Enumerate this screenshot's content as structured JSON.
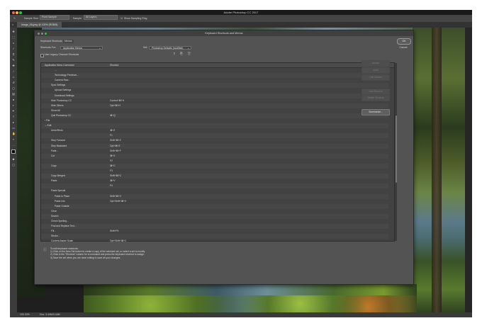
{
  "app": {
    "title": "Adobe Photoshop CC 2017"
  },
  "options_bar": {
    "sample_size_label": "Sample Size:",
    "sample_size_value": "Point Sample",
    "sample_label": "Sample:",
    "sample_value": "All Layers",
    "show_ring_label": "Show Sampling Ring"
  },
  "document": {
    "tab_label": "Image_06.jpeg @ 100% (RGB/8)",
    "zoom": "100.33%",
    "doc_info": "Doc: 3.44M/3.44M"
  },
  "dialog": {
    "title": "Keyboard Shortcuts and Menus",
    "tab_label": "Keyboard Shortcuts",
    "tab2_label": "Menus",
    "shortcuts_for_label": "Shortcuts For:",
    "shortcuts_for_value": "Application Menus",
    "set_label": "Set:",
    "set_value": "Photoshop Defaults (modified)",
    "legacy_label": "Use Legacy Channel Shortcuts",
    "col_command": "Application Menu Command",
    "col_shortcut": "Shortcut",
    "buttons": {
      "accept": "Accept",
      "undo": "Undo",
      "use_default": "Use Default",
      "add_shortcut": "Add Shortcut",
      "delete_shortcut": "Delete Shortcut",
      "summarize": "Summarize..."
    },
    "ok": "OK",
    "cancel": "Cancel",
    "instructions": [
      "To edit keyboard shortcuts:",
      "1) Click on the New Set button to create a copy of the selected set, or select a set to modify.",
      "2) Click in the \"Shortcut\" column for a command and press the keyboard shortcut to assign.",
      "3) Save the set when you are done editing to save all your changes."
    ],
    "rows": [
      {
        "cmd": "...",
        "sc": "",
        "indent": 2
      },
      {
        "cmd": "Technology Previews...",
        "sc": "",
        "indent": 2
      },
      {
        "cmd": "Camera Raw...",
        "sc": "",
        "indent": 2
      },
      {
        "cmd": "Sync Settings",
        "sc": "",
        "indent": 1
      },
      {
        "cmd": "Upload Settings",
        "sc": "",
        "indent": 2
      },
      {
        "cmd": "Download Settings",
        "sc": "",
        "indent": 2
      },
      {
        "cmd": "Hide Photoshop CC",
        "sc": "Control+⌘+H",
        "indent": 1
      },
      {
        "cmd": "Hide Others",
        "sc": "Opt+⌘+H",
        "indent": 1
      },
      {
        "cmd": "Show All",
        "sc": "",
        "indent": 1
      },
      {
        "cmd": "Quit Photoshop CC",
        "sc": "⌘+Q",
        "indent": 1
      },
      {
        "cmd": "› File",
        "sc": "",
        "indent": 0
      },
      {
        "cmd": "⌄ Edit",
        "sc": "",
        "indent": 0
      },
      {
        "cmd": "Undo/Redo",
        "sc": "⌘+Z",
        "indent": 1
      },
      {
        "cmd": "",
        "sc": "F1",
        "indent": 1
      },
      {
        "cmd": "Step Forward",
        "sc": "Shift+⌘+Z",
        "indent": 1
      },
      {
        "cmd": "Step Backward",
        "sc": "Opt+⌘+Z",
        "indent": 1
      },
      {
        "cmd": "Fade...",
        "sc": "Shift+⌘+F",
        "indent": 1
      },
      {
        "cmd": "Cut",
        "sc": "⌘+X",
        "indent": 1
      },
      {
        "cmd": "",
        "sc": "F2",
        "indent": 1
      },
      {
        "cmd": "Copy",
        "sc": "⌘+C",
        "indent": 1
      },
      {
        "cmd": "",
        "sc": "F3",
        "indent": 1
      },
      {
        "cmd": "Copy Merged",
        "sc": "Shift+⌘+C",
        "indent": 1
      },
      {
        "cmd": "Paste",
        "sc": "⌘+V",
        "indent": 1
      },
      {
        "cmd": "",
        "sc": "F4",
        "indent": 1
      },
      {
        "cmd": "Paste Special",
        "sc": "",
        "indent": 1
      },
      {
        "cmd": "Paste in Place",
        "sc": "Shift+⌘+V",
        "indent": 2
      },
      {
        "cmd": "Paste Into",
        "sc": "Opt+Shift+⌘+V",
        "indent": 2
      },
      {
        "cmd": "Paste Outside",
        "sc": "",
        "indent": 2
      },
      {
        "cmd": "Clear",
        "sc": "",
        "indent": 1
      },
      {
        "cmd": "Search",
        "sc": "",
        "indent": 1
      },
      {
        "cmd": "Check Spelling...",
        "sc": "",
        "indent": 1
      },
      {
        "cmd": "Find and Replace Text...",
        "sc": "",
        "indent": 1
      },
      {
        "cmd": "Fill...",
        "sc": "Shift+F5",
        "indent": 1
      },
      {
        "cmd": "Stroke...",
        "sc": "",
        "indent": 1
      },
      {
        "cmd": "Content-Aware Scale",
        "sc": "Opt+Shift+⌘+C",
        "indent": 1
      }
    ]
  },
  "colors": {
    "accent_blue": "#2d6ac8",
    "close_red": "#ff5f57",
    "min_yellow": "#febc2e",
    "max_green": "#28c840"
  }
}
